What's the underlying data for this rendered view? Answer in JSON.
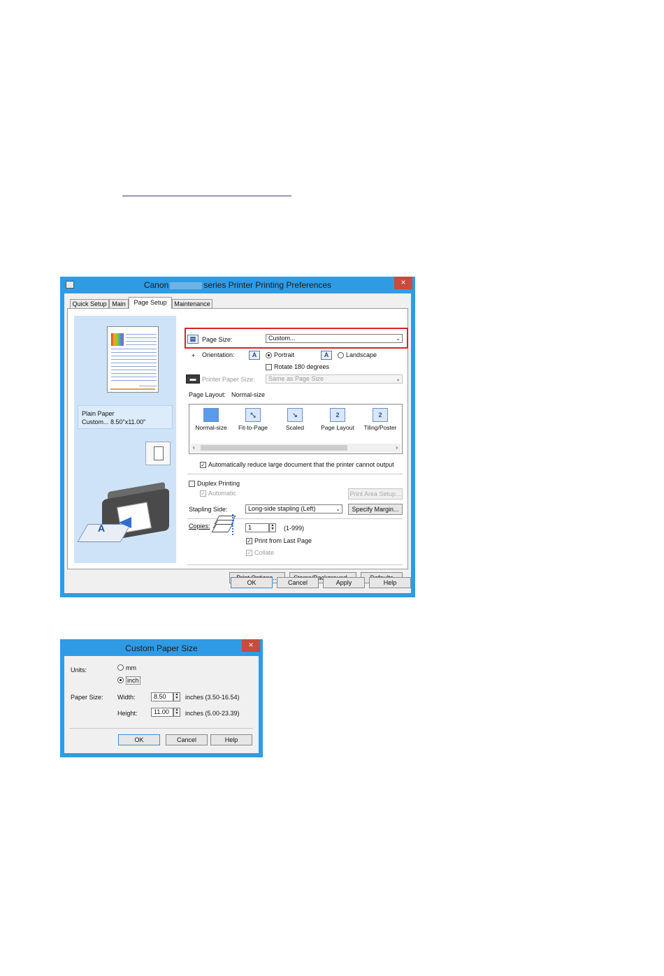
{
  "main_dialog": {
    "title_prefix": "Canon",
    "title_suffix": "series Printer Printing Preferences",
    "close": "×",
    "tabs": [
      {
        "label": "Quick Setup"
      },
      {
        "label": "Main"
      },
      {
        "label": "Page Setup",
        "active": true
      },
      {
        "label": "Maintenance"
      }
    ],
    "preview": {
      "media_type": "Plain Paper",
      "paper_info": "Custom... 8.50\"x11.00\""
    },
    "page_size": {
      "label": "Page Size:",
      "value": "Custom..."
    },
    "orientation": {
      "label": "Orientation:",
      "portrait": "Portrait",
      "landscape": "Landscape",
      "selected": "Portrait",
      "rotate_label": "Rotate 180 degrees",
      "rotate_checked": false
    },
    "printer_paper_size": {
      "label": "Printer Paper Size:",
      "value": "Same as Page Size"
    },
    "page_layout": {
      "label": "Page Layout:",
      "value": "Normal-size",
      "options": [
        {
          "label": "Normal-size",
          "glyph": ""
        },
        {
          "label": "Fit-to-Page",
          "glyph": "⤡"
        },
        {
          "label": "Scaled",
          "glyph": "↘"
        },
        {
          "label": "Page Layout",
          "glyph": "2"
        },
        {
          "label": "Tiling/Poster",
          "glyph": "2"
        }
      ],
      "scroll_left": "‹",
      "scroll_right": "›"
    },
    "auto_reduce": {
      "label": "Automatically reduce large document that the printer cannot output",
      "checked": true
    },
    "duplex": {
      "label": "Duplex Printing",
      "checked": false,
      "automatic_label": "Automatic",
      "automatic_checked": true
    },
    "print_area_setup": "Print Area Setup...",
    "stapling_side": {
      "label": "Stapling Side:",
      "value": "Long-side stapling (Left)"
    },
    "specify_margin": "Specify Margin...",
    "copies": {
      "label": "Copies:",
      "value": "1",
      "range": "(1-999)",
      "print_from_last": "Print from Last Page",
      "print_from_last_checked": true,
      "collate": "Collate",
      "collate_checked": true
    },
    "buttons": {
      "print_options": "Print Options...",
      "stamp_background": "Stamp/Background...",
      "defaults": "Defaults",
      "ok": "OK",
      "cancel": "Cancel",
      "apply": "Apply",
      "help": "Help"
    },
    "highlight_color": "#d8232a",
    "accent_color": "#2f9be5"
  },
  "custom_paper_dialog": {
    "title": "Custom Paper Size",
    "close": "×",
    "units_label": "Units:",
    "unit_mm": "mm",
    "unit_inch": "inch",
    "selected_unit": "inch",
    "paper_size_label": "Paper Size:",
    "width": {
      "label": "Width:",
      "value": "8.50",
      "range": "inches (3.50-16.54)"
    },
    "height": {
      "label": "Height:",
      "value": "11.00",
      "range": "inches (5.00-23.39)"
    },
    "buttons": {
      "ok": "OK",
      "cancel": "Cancel",
      "help": "Help"
    }
  }
}
